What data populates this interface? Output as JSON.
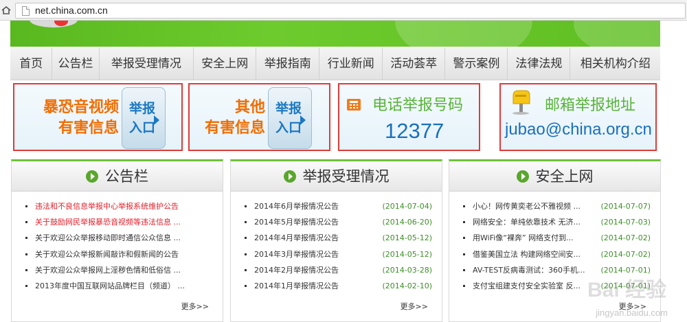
{
  "browser": {
    "url": "net.china.com.cn"
  },
  "nav": [
    "首页",
    "公告栏",
    "举报受理情况",
    "安全上网",
    "举报指南",
    "行业新闻",
    "活动荟萃",
    "警示案例",
    "法律法规",
    "相关机构介绍"
  ],
  "quick": {
    "box1": {
      "line1": "暴恐音视频",
      "line2": "有害信息",
      "btn1": "举报",
      "btn2": "入口"
    },
    "box2": {
      "line1": "其他",
      "line2": "有害信息",
      "btn1": "举报",
      "btn2": "入口"
    },
    "phone": {
      "label": "电话举报号码",
      "number": "12377"
    },
    "mail": {
      "label": "邮箱举报地址",
      "address": "jubao@china.org.cn"
    }
  },
  "panels": [
    {
      "title": "公告栏",
      "items": [
        {
          "text": "违法和不良信息举报中心举报系统维护公告",
          "red": true
        },
        {
          "text": "关于鼓励网民举报暴恐音视频等违法信息 ...",
          "red": true
        },
        {
          "text": "关于欢迎公众举报移动即时通信公众信息 ..."
        },
        {
          "text": "关于欢迎公众举报新闻敲诈和假新闻的公告"
        },
        {
          "text": "关于欢迎公众举报网上淫秽色情和低俗信 ..."
        },
        {
          "text": "2013年度中国互联网站品牌栏目（频道） ..."
        }
      ],
      "more": "更多>>"
    },
    {
      "title": "举报受理情况",
      "items": [
        {
          "text": "2014年6月举报情况公告",
          "date": "(2014-07-04)"
        },
        {
          "text": "2014年5月举报情况公告",
          "date": "(2014-06-20)"
        },
        {
          "text": "2014年4月举报情况公告",
          "date": "(2014-05-12)"
        },
        {
          "text": "2014年3月举报情况公告",
          "date": "(2014-05-12)"
        },
        {
          "text": "2014年2月举报情况公告",
          "date": "(2014-03-28)"
        },
        {
          "text": "2014年1月举报情况公告",
          "date": "(2014-02-10)"
        }
      ],
      "more": "更多>>"
    },
    {
      "title": "安全上网",
      "items": [
        {
          "text": "小心！网传黄奕老公不雅视频 ...",
          "date": "(2014-07-07)"
        },
        {
          "text": "网络安全：单纯依靠技术 无济...",
          "date": "(2014-07-03)"
        },
        {
          "text": "用WiFi像“裸奔” 网络支付到...",
          "date": "(2014-07-02)"
        },
        {
          "text": "借鉴美国立法 构建网络空间安...",
          "date": "(2014-07-02)"
        },
        {
          "text": "AV-TEST反病毒测试：360手机...",
          "date": "(2014-07-01)"
        },
        {
          "text": "支付宝组建支付安全实验室 反...",
          "date": "(2014-07-01)"
        }
      ],
      "more": "更多>>"
    }
  ],
  "watermark": {
    "text": "Bai 经验",
    "sub": "jingyan.baidu.com"
  }
}
